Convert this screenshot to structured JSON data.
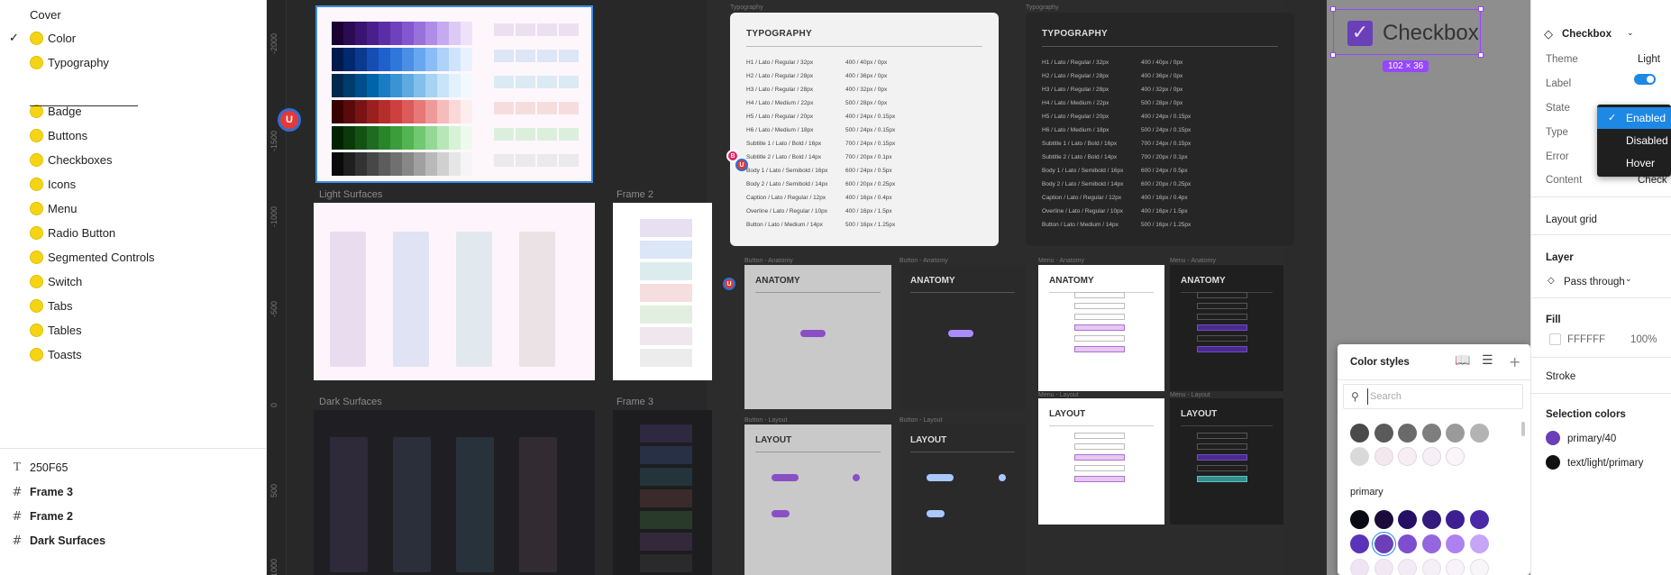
{
  "pages": {
    "items": [
      {
        "label": "Cover",
        "dot": false,
        "checked": false
      },
      {
        "label": "Color",
        "dot": true,
        "checked": true
      },
      {
        "label": "Typography",
        "dot": true,
        "checked": false
      },
      {
        "label": "Badge",
        "dot": true,
        "checked": false
      },
      {
        "label": "Buttons",
        "dot": true,
        "checked": false
      },
      {
        "label": "Checkboxes",
        "dot": true,
        "checked": false
      },
      {
        "label": "Icons",
        "dot": true,
        "checked": false
      },
      {
        "label": "Menu",
        "dot": true,
        "checked": false
      },
      {
        "label": "Radio Button",
        "dot": true,
        "checked": false
      },
      {
        "label": "Segmented Controls",
        "dot": true,
        "checked": false
      },
      {
        "label": "Switch",
        "dot": true,
        "checked": false
      },
      {
        "label": "Tabs",
        "dot": true,
        "checked": false
      },
      {
        "label": "Tables",
        "dot": true,
        "checked": false
      },
      {
        "label": "Toasts",
        "dot": true,
        "checked": false
      }
    ],
    "divider_text": "_____________________"
  },
  "layers": {
    "items": [
      {
        "label": "250F65",
        "icon": "text-icon",
        "glyph": "T",
        "bold": false
      },
      {
        "label": "Frame 3",
        "icon": "frame-icon",
        "glyph": "#",
        "bold": true
      },
      {
        "label": "Frame 2",
        "icon": "frame-icon",
        "glyph": "#",
        "bold": true
      },
      {
        "label": "Dark Surfaces",
        "icon": "frame-icon",
        "glyph": "#",
        "bold": true
      }
    ]
  },
  "canvas": {
    "ruler_labels": [
      "-2000",
      "-1500",
      "-1000",
      "-500",
      "0",
      "500",
      "1000"
    ],
    "frame_labels": {
      "light_surfaces": "Light Surfaces",
      "frame2": "Frame 2",
      "dark_surfaces": "Dark Surfaces",
      "frame3": "Frame 3",
      "typography_light": "Typography",
      "typography_dark": "Typography",
      "button_anatomy_1": "Button - Anatomy",
      "button_anatomy_2": "Button - Anatomy",
      "menu_anatomy_1": "Menu - Anatomy",
      "menu_anatomy_2": "Menu - Anatomy",
      "button_layout_1": "Button - Layout",
      "button_layout_2": "Button - Layout",
      "menu_layout_1": "Menu - Layout",
      "menu_layout_2": "Menu - Layout"
    },
    "typography": {
      "title": "TYPOGRAPHY",
      "rows": [
        [
          "H1 / Lato / Regular / 32px",
          "400 / 40px / 0px"
        ],
        [
          "H2 / Lato / Regular / 28px",
          "400 / 36px / 0px"
        ],
        [
          "H3 / Lato / Regular / 28px",
          "400 / 32px / 0px"
        ],
        [
          "H4 / Lato / Medium / 22px",
          "500 / 28px / 0px"
        ],
        [
          "H5 / Lato / Regular / 20px",
          "400 / 24px / 0.15px"
        ],
        [
          "H6 / Lato / Medium / 18px",
          "500 / 24px / 0.15px"
        ],
        [
          "Subtitle 1 / Lato / Bold / 16px",
          "700 / 24px / 0.15px"
        ],
        [
          "Subtitle 2 / Lato / Bold / 14px",
          "700 / 20px / 0.1px"
        ],
        [
          "Body 1 / Lato / Semibold / 16px",
          "600 / 24px / 0.5px"
        ],
        [
          "Body 2 / Lato / Semibold / 14px",
          "600 / 20px / 0.25px"
        ],
        [
          "Caption / Lato / Regular / 12px",
          "400 / 16px / 0.4px"
        ],
        [
          "Overline / Lato / Regular / 10px",
          "400 / 16px / 1.5px"
        ],
        [
          "Button / Lato / Medium / 14px",
          "500 / 16px / 1.25px"
        ]
      ]
    },
    "cards": {
      "anatomy": "ANATOMY",
      "layout": "LAYOUT"
    },
    "selected_component": {
      "label": "Checkbox",
      "size_badge": "102 × 36"
    },
    "cursors": {
      "user_initial": "U",
      "other_initial": "B"
    }
  },
  "color_styles": {
    "title": "Color styles",
    "search_placeholder": "Search",
    "section_label": "primary",
    "grey_row_1": [
      "#4a4a4a",
      "#5a5a5a",
      "#6a6a6a",
      "#7e7e7e",
      "#9a9a9a",
      "#b3b3b3"
    ],
    "grey_row_2": [
      "#d9d9d9",
      "#f3e8ee",
      "#f7eef4",
      "#f6f0f6",
      "#f9f5f9"
    ],
    "primary_row_1": [
      "#0a0a14",
      "#1a0b3a",
      "#250f65",
      "#331a7c",
      "#3e1f92",
      "#4a28a6"
    ],
    "primary_row_2": [
      "#5a34b8",
      "#6a3fb8",
      "#7d4fd0",
      "#9466e0",
      "#ad82f0",
      "#c6a5f7"
    ],
    "selected_index": 1
  },
  "properties": {
    "component_name": "Checkbox",
    "theme_label": "Theme",
    "theme_value": "Light",
    "label_label": "Label",
    "label_on": true,
    "state_label": "State",
    "type_label": "Type",
    "error_label": "Error",
    "content_label": "Content",
    "content_value": "Check",
    "layout_grid": "Layout grid",
    "layer": "Layer",
    "blend_mode": "Pass through",
    "fill": "Fill",
    "fill_hex": "FFFFFF",
    "fill_opacity": "100%",
    "stroke": "Stroke",
    "selection_colors": "Selection colors",
    "selection_color_1": {
      "name": "primary/40",
      "color": "#6a3fb8"
    },
    "selection_color_2": {
      "name": "text/light/primary",
      "color": "#111111"
    },
    "state_options": [
      {
        "label": "Enabled",
        "selected": true
      },
      {
        "label": "Disabled",
        "selected": false
      },
      {
        "label": "Hover",
        "selected": false
      }
    ]
  },
  "palette_colors": {
    "row1": [
      "#1a0033",
      "#2b0b52",
      "#3a1470",
      "#4a1f8c",
      "#5c2ea6",
      "#7040bd",
      "#8456d0",
      "#9a70dc",
      "#b08ce6",
      "#c6aaef",
      "#dccaf5",
      "#ede2fa"
    ],
    "row2": [
      "#001a4d",
      "#00296e",
      "#0a3a8f",
      "#154db3",
      "#2060cc",
      "#3077dc",
      "#4a8ee6",
      "#68a6ef",
      "#8abcf5",
      "#aed2fa",
      "#cfe4fc",
      "#e8f2fe"
    ],
    "row3": [
      "#002a4d",
      "#003c6b",
      "#004e8a",
      "#0064a8",
      "#1a7cc2",
      "#3a94d4",
      "#5eaae0",
      "#82bfea",
      "#a6d3f2",
      "#c7e4f8",
      "#e2f1fc",
      "#f2f9fe"
    ],
    "row4": [
      "#3a0000",
      "#5a0a0a",
      "#7a1414",
      "#9a1f1f",
      "#b52d2d",
      "#cc4040",
      "#dc5a5a",
      "#e67878",
      "#ef9a9a",
      "#f5bcbc",
      "#fad8d8",
      "#fdeeee"
    ],
    "row5": [
      "#002200",
      "#0a3a0a",
      "#145214",
      "#1f6b1f",
      "#2a842a",
      "#3a9c3a",
      "#52b452",
      "#70c870",
      "#94d894",
      "#b8e6b8",
      "#d8f2d8",
      "#eef9ee"
    ],
    "row6": [
      "#0a0a0a",
      "#1f1f1f",
      "#333333",
      "#474747",
      "#5c5c5c",
      "#707070",
      "#878787",
      "#a0a0a0",
      "#b9b9b9",
      "#d0d0d0",
      "#e6e6e6",
      "#f5f5f5"
    ]
  }
}
